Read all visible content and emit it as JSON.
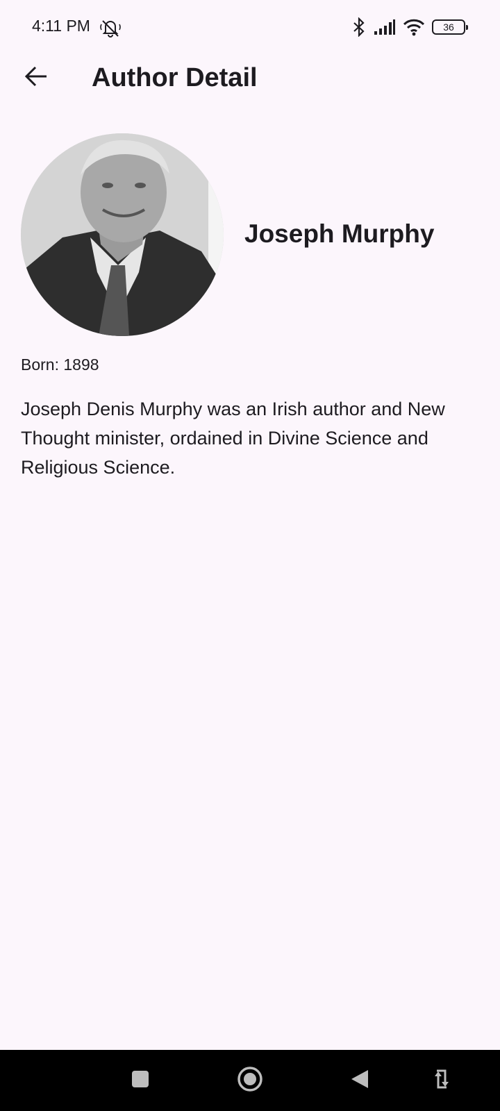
{
  "status_bar": {
    "time": "4:11 PM",
    "battery": "36",
    "icons": [
      "mute-icon",
      "bluetooth-icon",
      "signal-icon",
      "wifi-icon",
      "battery-icon"
    ]
  },
  "app_bar": {
    "title": "Author Detail",
    "back_icon": "arrow-back-icon"
  },
  "author": {
    "name": "Joseph Murphy",
    "born": "Born: 1898",
    "bio": "Joseph Denis Murphy was an Irish author and New Thought minister, ordained in Divine Science and Religious Science."
  },
  "nav_bar": {
    "icons": [
      "recents-icon",
      "home-icon",
      "back-icon",
      "rotate-icon"
    ]
  },
  "colors": {
    "background": "#fcf6fc",
    "text": "#1d1b20",
    "nav_bar": "#000000"
  }
}
